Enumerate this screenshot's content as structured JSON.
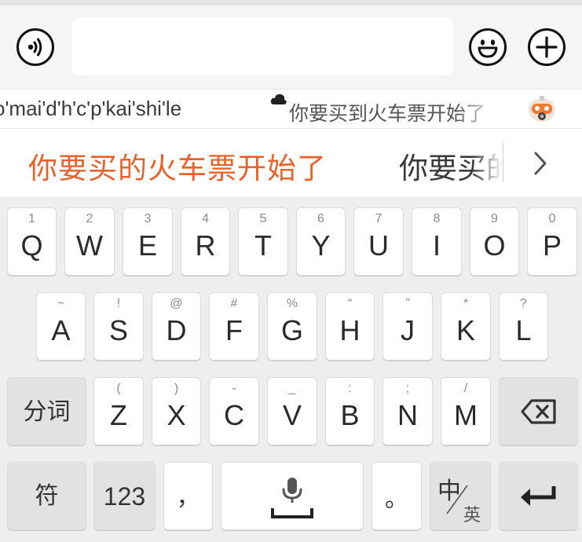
{
  "chat": {
    "input_value": "",
    "voice_icon": "voice-wave-icon",
    "emoji_icon": "smile-face-icon",
    "plus_icon": "plus-circle-icon"
  },
  "pinyin": {
    "text": "o'mai'd'h'c'p'kai'shi'le",
    "cloud_icon": "cloud-icon",
    "cloud_prediction": "你要买到火车票开始了",
    "assistant_icon": "robot-icon"
  },
  "candidates": {
    "first": "你要买的火车票开始了",
    "second": "你要买的",
    "more_icon": "chevron-right-icon",
    "accent_color": "#e8622c"
  },
  "keyboard": {
    "row1": [
      {
        "hint": "1",
        "key": "Q"
      },
      {
        "hint": "2",
        "key": "W"
      },
      {
        "hint": "3",
        "key": "E"
      },
      {
        "hint": "4",
        "key": "R"
      },
      {
        "hint": "5",
        "key": "T"
      },
      {
        "hint": "6",
        "key": "Y"
      },
      {
        "hint": "7",
        "key": "U"
      },
      {
        "hint": "8",
        "key": "I"
      },
      {
        "hint": "9",
        "key": "O"
      },
      {
        "hint": "0",
        "key": "P"
      }
    ],
    "row2": [
      {
        "hint": "~",
        "key": "A"
      },
      {
        "hint": "!",
        "key": "S"
      },
      {
        "hint": "@",
        "key": "D"
      },
      {
        "hint": "#",
        "key": "F"
      },
      {
        "hint": "%",
        "key": "G"
      },
      {
        "hint": "“",
        "key": "H"
      },
      {
        "hint": "”",
        "key": "J"
      },
      {
        "hint": "*",
        "key": "K"
      },
      {
        "hint": "?",
        "key": "L"
      }
    ],
    "row3": [
      {
        "hint": "(",
        "key": "Z"
      },
      {
        "hint": ")",
        "key": "X"
      },
      {
        "hint": "-",
        "key": "C"
      },
      {
        "hint": "_",
        "key": "V"
      },
      {
        "hint": ":",
        "key": "B"
      },
      {
        "hint": ";",
        "key": "N"
      },
      {
        "hint": "/",
        "key": "M"
      }
    ],
    "segment_label": "分词",
    "symbol_label": "符",
    "numbers_label": "123",
    "comma_label": "，",
    "period_label": "。",
    "lang_primary": "中",
    "lang_secondary": "英",
    "backspace_icon": "backspace-icon",
    "enter_icon": "enter-icon",
    "mic_icon": "microphone-icon",
    "space_icon": "space-bar-icon"
  }
}
